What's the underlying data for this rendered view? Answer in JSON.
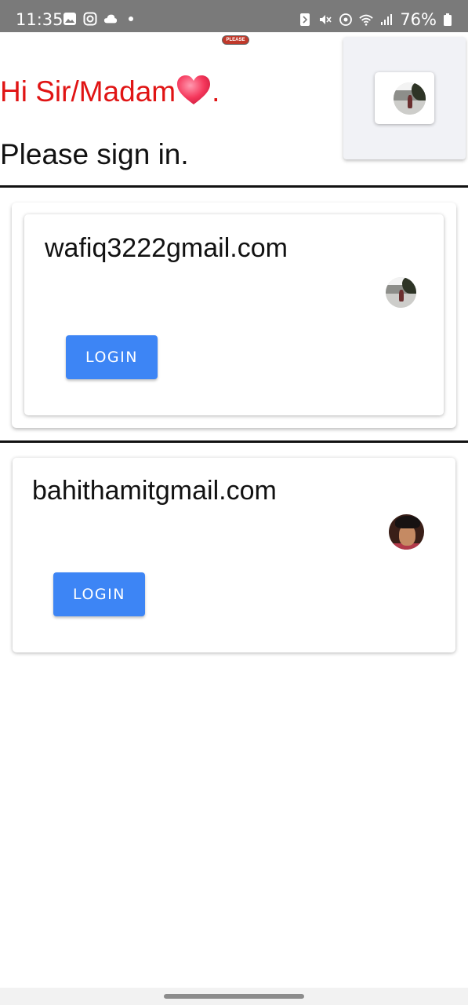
{
  "status_bar": {
    "time": "11:35",
    "battery": "76%",
    "left_icons": [
      "gallery-icon",
      "instagram-icon",
      "cloud-icon",
      "dot-icon"
    ],
    "right_icons": [
      "nfc-icon",
      "mute-icon",
      "hotspot-icon",
      "wifi-icon",
      "signal-icon",
      "battery-icon"
    ]
  },
  "header": {
    "logo_text": "PLEASE",
    "greeting": "Hi Sir/Madam",
    "greeting_suffix": ".",
    "subtitle": "Please sign in."
  },
  "accounts": [
    {
      "email": "wafiq3222gmail.com",
      "login_label": "LOGIN"
    },
    {
      "email": "bahithamitgmail.com",
      "login_label": "LOGIN"
    }
  ],
  "colors": {
    "greeting": "#e01414",
    "button": "#3d85f5",
    "status_bar": "#7a7a7a"
  }
}
